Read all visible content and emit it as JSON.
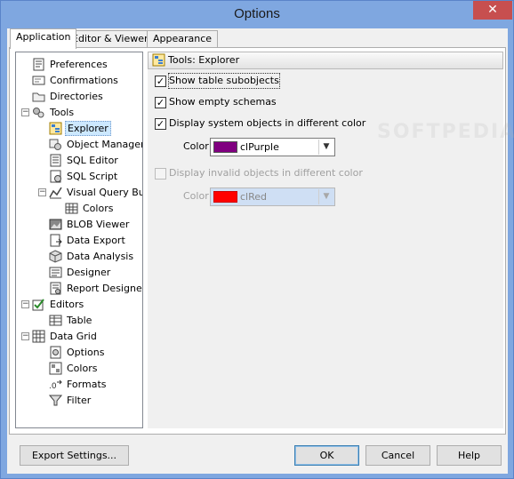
{
  "window": {
    "title": "Options",
    "close_symbol": "✕"
  },
  "tabs": [
    {
      "label": "Application",
      "active": true
    },
    {
      "label": "Editor & Viewers",
      "active": false
    },
    {
      "label": "Appearance",
      "active": false
    }
  ],
  "tree": {
    "items": [
      {
        "label": "Preferences",
        "icon": "preferences-icon"
      },
      {
        "label": "Confirmations",
        "icon": "confirmations-icon"
      },
      {
        "label": "Directories",
        "icon": "directories-icon"
      },
      {
        "label": "Tools",
        "icon": "tools-icon",
        "expander": "−"
      },
      {
        "label": "Explorer",
        "icon": "explorer-icon",
        "selected": true
      },
      {
        "label": "Object Manager",
        "icon": "object-manager-icon"
      },
      {
        "label": "SQL Editor",
        "icon": "sql-editor-icon"
      },
      {
        "label": "SQL Script",
        "icon": "sql-script-icon"
      },
      {
        "label": "Visual Query Build",
        "icon": "visual-query-icon",
        "expander": "−"
      },
      {
        "label": "Colors",
        "icon": "colors-grid-icon"
      },
      {
        "label": "BLOB Viewer",
        "icon": "blob-viewer-icon"
      },
      {
        "label": "Data Export",
        "icon": "data-export-icon"
      },
      {
        "label": "Data Analysis",
        "icon": "data-analysis-icon"
      },
      {
        "label": "Designer",
        "icon": "designer-icon"
      },
      {
        "label": "Report Designer",
        "icon": "report-designer-icon"
      },
      {
        "label": "Editors",
        "icon": "editors-icon",
        "expander": "−"
      },
      {
        "label": "Table",
        "icon": "table-icon"
      },
      {
        "label": "Data Grid",
        "icon": "data-grid-icon",
        "expander": "−"
      },
      {
        "label": "Options",
        "icon": "options-icon"
      },
      {
        "label": "Colors",
        "icon": "colors-icon"
      },
      {
        "label": "Formats",
        "icon": "formats-icon"
      },
      {
        "label": "Filter",
        "icon": "filter-icon"
      }
    ]
  },
  "panel": {
    "header": "Tools: Explorer",
    "watermark": "SOFTPEDIA",
    "options": [
      {
        "label": "Show table subobjects",
        "checked": true,
        "enabled": true
      },
      {
        "label": "Show empty schemas",
        "checked": true,
        "enabled": true
      },
      {
        "label": "Display system objects in different color",
        "checked": true,
        "enabled": true
      },
      {
        "label": "Display invalid objects in different color",
        "checked": false,
        "enabled": false
      }
    ],
    "system_color": {
      "label": "Color",
      "value": "clPurple",
      "swatch": "#800080",
      "enabled": true
    },
    "invalid_color": {
      "label": "Color",
      "value": "clRed",
      "swatch": "#ff0000",
      "enabled": false
    }
  },
  "buttons": {
    "export": "Export Settings...",
    "ok": "OK",
    "cancel": "Cancel",
    "help": "Help"
  },
  "check_glyph": "✓",
  "arrow_glyph": "▼"
}
